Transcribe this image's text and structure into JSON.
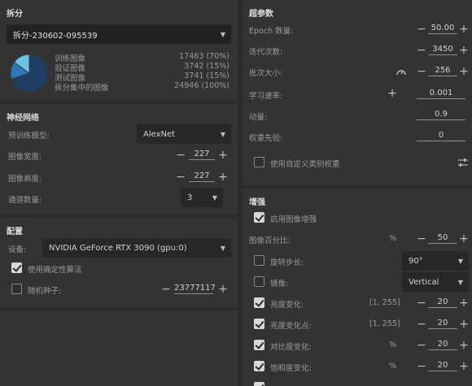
{
  "split": {
    "title": "拆分",
    "selected": "拆分-230602-095539",
    "legend": [
      {
        "label": "训练图像",
        "value": "17463 (70%)",
        "color": "#1e3e66",
        "fraction": 0.7
      },
      {
        "label": "验证图像",
        "value": "3742 (15%)",
        "color": "#2e77b8",
        "fraction": 0.15
      },
      {
        "label": "测试图像",
        "value": "3741 (15%)",
        "color": "#70bfe6",
        "fraction": 0.15
      },
      {
        "label": "拆分集中的图像",
        "value": "24946 (100%)"
      }
    ]
  },
  "network": {
    "title": "神经网络",
    "pretrained_label": "预训练模型:",
    "pretrained_value": "AlexNet",
    "width_label": "图像宽度:",
    "width_value": "227",
    "height_label": "图像高度:",
    "height_value": "227",
    "channels_label": "通道数量:",
    "channels_value": "3"
  },
  "config": {
    "title": "配置",
    "device_label": "设备:",
    "device_value": "NVIDIA GeForce RTX 3090 (gpu:0)",
    "deterministic_label": "使用确定性算法",
    "deterministic_checked": true,
    "seed_label": "随机种子:",
    "seed_checked": false,
    "seed_value": "23777117"
  },
  "hyper": {
    "title": "超参数",
    "epoch_label": "Epoch 数量:",
    "epoch_value": "50.00",
    "iter_label": "迭代次数:",
    "iter_value": "3450",
    "batch_label": "批次大小:",
    "batch_value": "256",
    "lr_label": "学习速率:",
    "lr_value": "0.001",
    "momentum_label": "动量:",
    "momentum_value": "0.9",
    "decay_label": "权重先验:",
    "decay_value": "0",
    "custom_weight_label": "使用自定义类别权重",
    "custom_weight_checked": false
  },
  "augment": {
    "title": "增强",
    "enable_label": "启用图像增强",
    "enable_checked": true,
    "scale_label": "图像百分比:",
    "scale_unit": "%",
    "scale_value": "50",
    "rotation_label": "旋转步长:",
    "rotation_checked": false,
    "rotation_value": "90°",
    "mirror_label": "镜像:",
    "mirror_checked": false,
    "mirror_value": "Vertical",
    "rows": [
      {
        "label": "亮度变化:",
        "range": "[1, 255]",
        "value": "20",
        "checked": true
      },
      {
        "label": "亮度变化点:",
        "range": "[1, 255]",
        "value": "20",
        "checked": true
      },
      {
        "label": "对比度变化:",
        "range": "%",
        "value": "20",
        "checked": true
      },
      {
        "label": "饱和度变化:",
        "range": "%",
        "value": "20",
        "checked": true
      }
    ]
  }
}
